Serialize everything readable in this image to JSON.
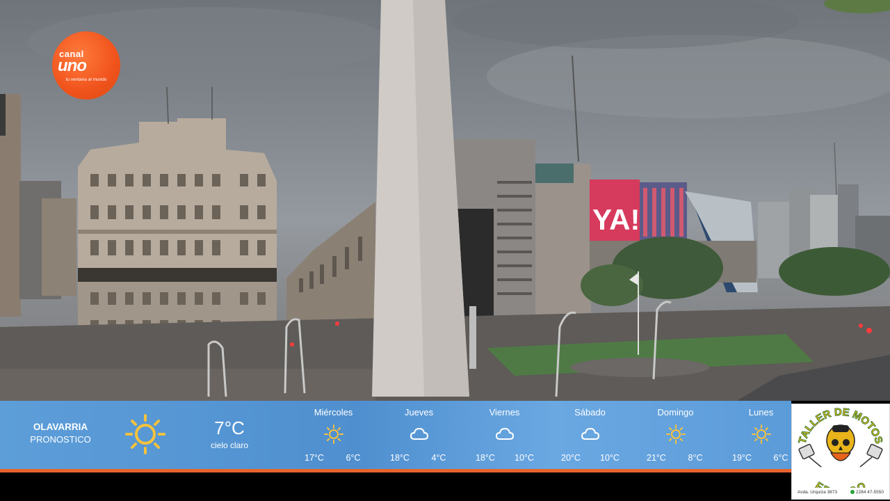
{
  "logo": {
    "top": "canal",
    "main": "uno",
    "tagline": "tu ventana al mundo",
    "color": "#f0531c"
  },
  "weather": {
    "city": "OLAVARRIA",
    "subtitle": "PRONOSTICO",
    "current": {
      "temp": "7°C",
      "desc": "cielo claro",
      "icon": "sun-icon"
    },
    "days": [
      {
        "name": "Miércoles",
        "icon": "sun-icon",
        "hi": "17°C",
        "lo": "6°C"
      },
      {
        "name": "Jueves",
        "icon": "cloud-icon",
        "hi": "18°C",
        "lo": "4°C"
      },
      {
        "name": "Viernes",
        "icon": "cloud-icon",
        "hi": "18°C",
        "lo": "10°C"
      },
      {
        "name": "Sábado",
        "icon": "cloud-icon",
        "hi": "20°C",
        "lo": "10°C"
      },
      {
        "name": "Domingo",
        "icon": "sun-icon",
        "hi": "21°C",
        "lo": "8°C"
      },
      {
        "name": "Lunes",
        "icon": "sun-icon",
        "hi": "19°C",
        "lo": "6°C"
      }
    ],
    "bar_color": "#5d9ed9",
    "accent_color": "#e8642c"
  },
  "sponsor": {
    "title_top": "TALLER DE MOTOS",
    "title_bottom": "FRANCO",
    "address": "Avda. Urquiza 3873",
    "phone": "2284 47-5550"
  },
  "billboard": {
    "text": "YA!"
  }
}
